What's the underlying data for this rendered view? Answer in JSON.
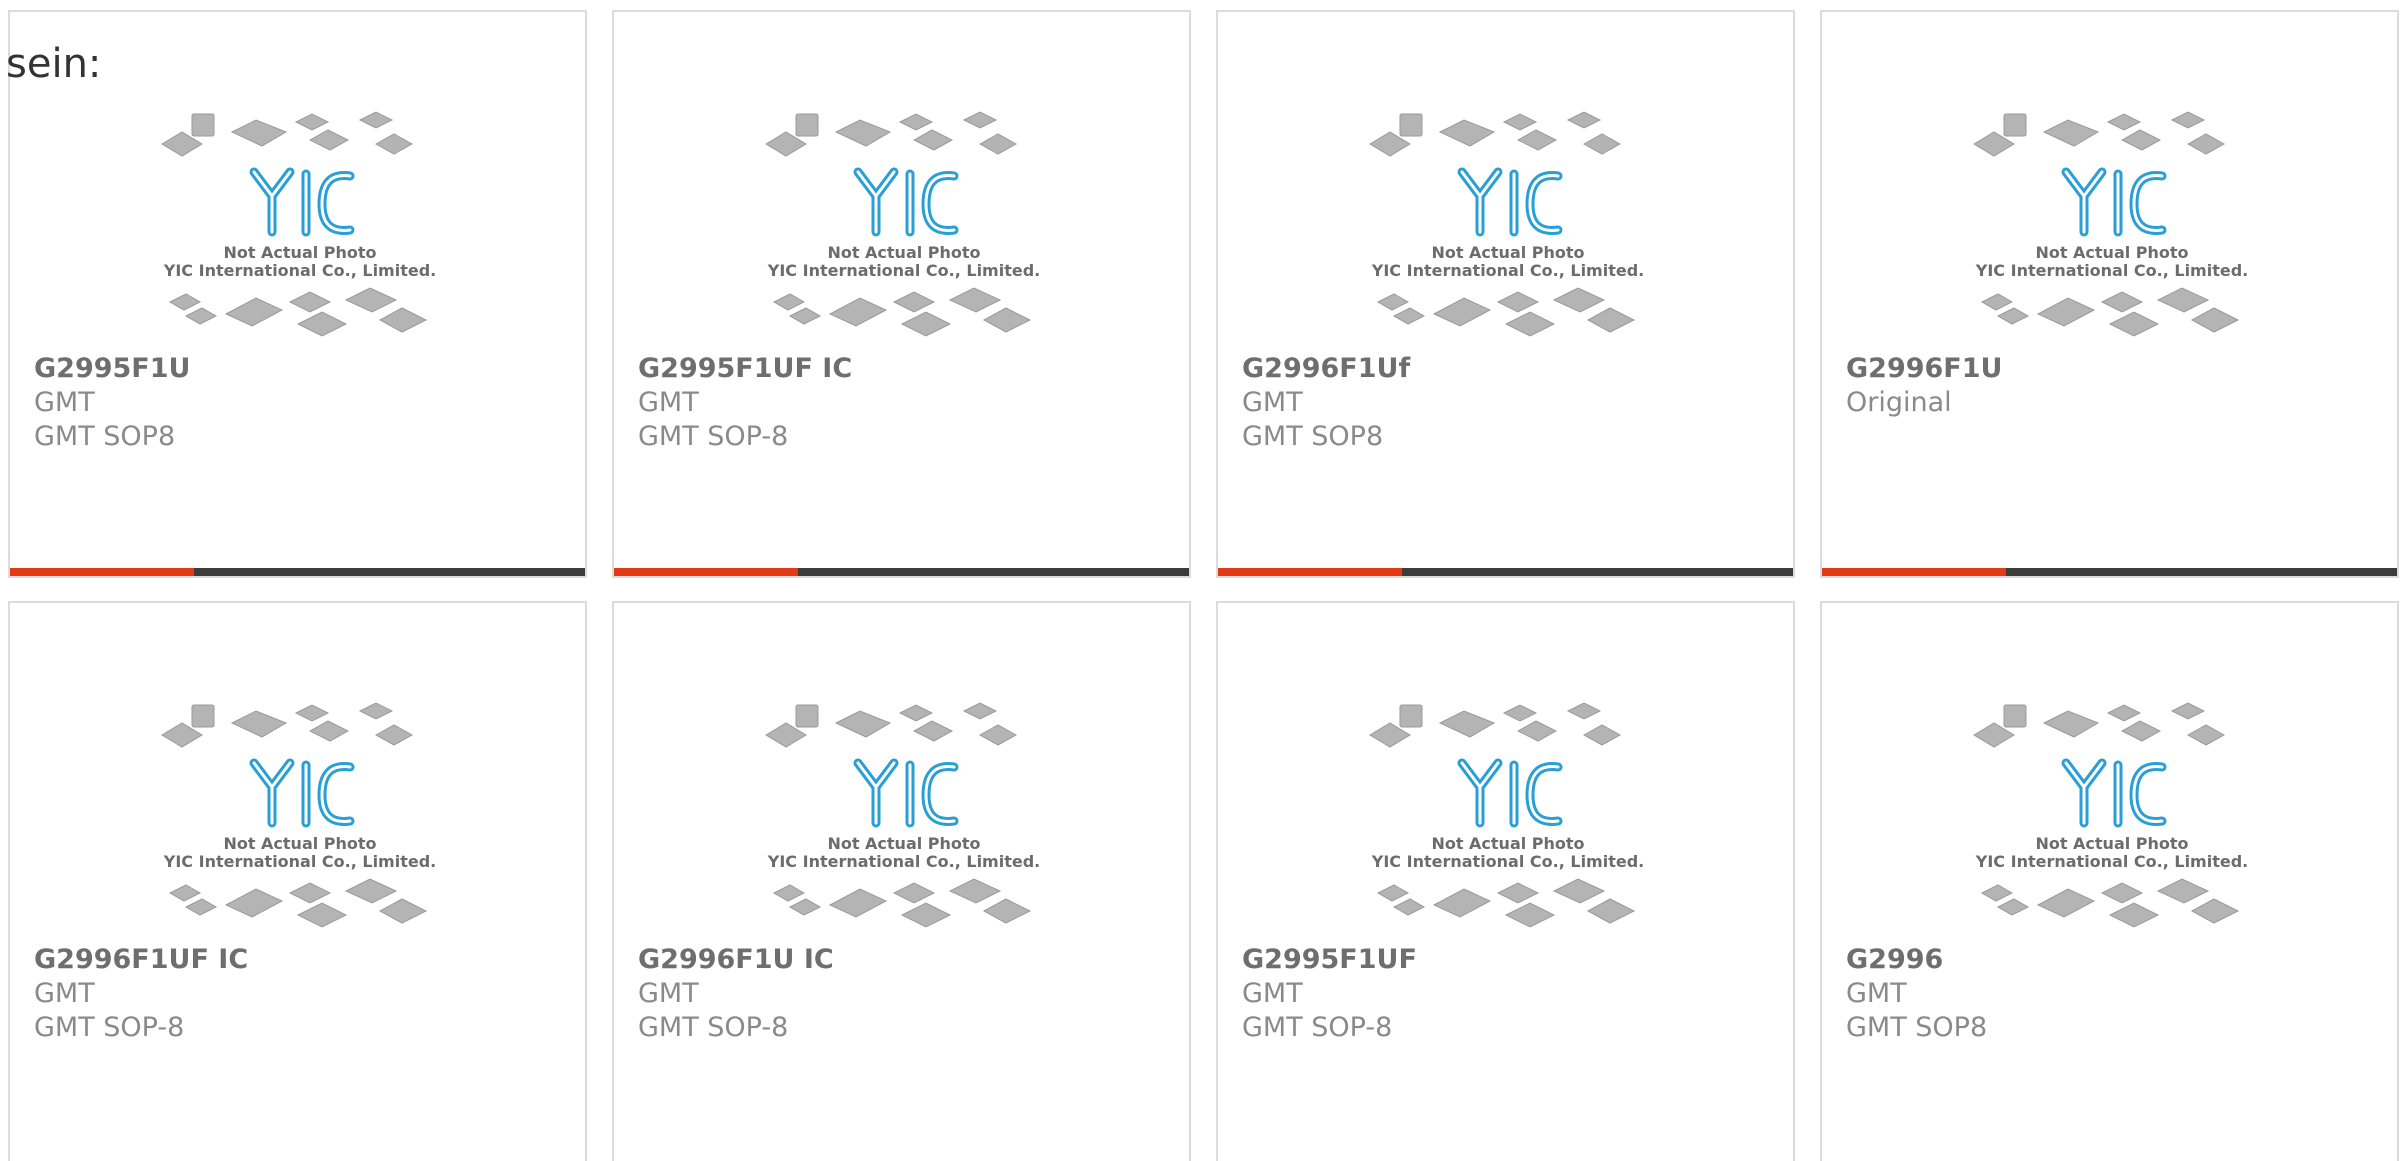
{
  "overlay_text": "sein:",
  "image_caption": {
    "line1": "Not Actual Photo",
    "line2": "YIC International Co., Limited.",
    "logo_text": "YIC"
  },
  "colors": {
    "progress_fill": "#e23a14",
    "progress_track": "#3c3c3c",
    "card_border": "#dcdcdc",
    "logo_blue": "#2a9fd6"
  },
  "products": [
    {
      "part": "G2995F1U",
      "line1": "GMT",
      "line2": "GMT SOP8",
      "progress": 0.32
    },
    {
      "part": "G2995F1UF IC",
      "line1": "GMT",
      "line2": "GMT SOP-8",
      "progress": 0.32
    },
    {
      "part": "G2996F1Uf",
      "line1": "GMT",
      "line2": "GMT SOP8",
      "progress": 0.32
    },
    {
      "part": "G2996F1U",
      "line1": "Original",
      "line2": "",
      "progress": 0.32
    },
    {
      "part": "G2996F1UF IC",
      "line1": "GMT",
      "line2": "GMT SOP-8",
      "progress": 0
    },
    {
      "part": "G2996F1U IC",
      "line1": "GMT",
      "line2": "GMT SOP-8",
      "progress": 0
    },
    {
      "part": "G2995F1UF",
      "line1": "GMT",
      "line2": "GMT SOP-8",
      "progress": 0
    },
    {
      "part": "G2996",
      "line1": "GMT",
      "line2": "GMT SOP8",
      "progress": 0
    }
  ]
}
